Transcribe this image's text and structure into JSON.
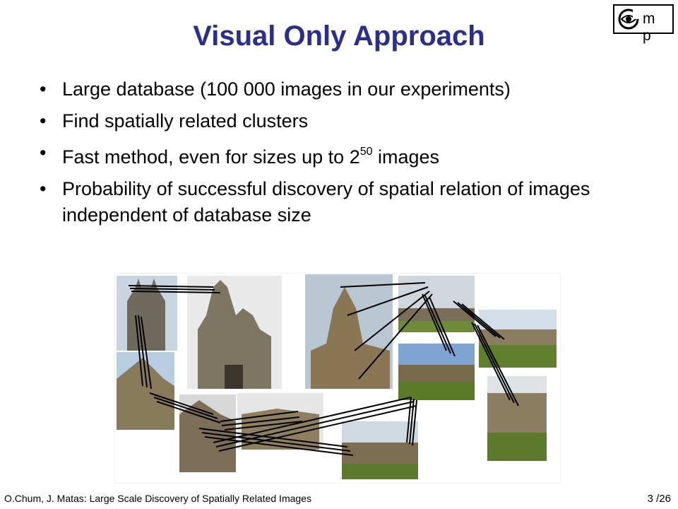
{
  "logo": {
    "letters": "m p"
  },
  "slide": {
    "title": "Visual Only Approach",
    "bullets": [
      {
        "text": "Large database (100 000 images in our experiments)"
      },
      {
        "text": "Find  spatially related clusters"
      },
      {
        "text_before": "Fast method, even for sizes up to 2",
        "superscript": "50",
        "text_after": " images"
      },
      {
        "text": "Probability of successful discovery of spatial relation of images independent of  database size"
      }
    ]
  },
  "footer": {
    "citation": "O.Chum, J. Matas: Large Scale Discovery of Spatially Related Images",
    "page_number": "3",
    "page_total": "/26"
  }
}
